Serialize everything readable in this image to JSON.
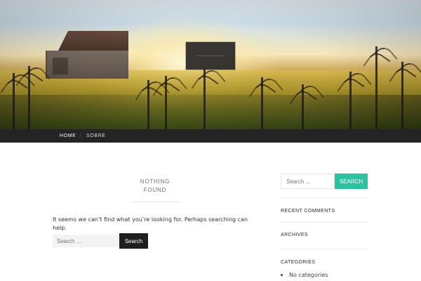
{
  "nav": {
    "items": [
      {
        "label": "HOME",
        "active": true
      },
      {
        "label": "SOBRE",
        "active": false
      }
    ]
  },
  "main": {
    "not_found": {
      "title_line_1": "NOTHING",
      "title_line_2": "FOUND",
      "message": "It seems we can’t find what you’re looking for. Perhaps searching can help."
    },
    "search": {
      "placeholder": "Search …",
      "button_label": "Search"
    }
  },
  "sidebar": {
    "search": {
      "placeholder": "Search …",
      "button_label": "SEARCH"
    },
    "widgets": [
      {
        "heading": "RECENT COMMENTS"
      },
      {
        "heading": "ARCHIVES"
      },
      {
        "heading": "CATEGORIES"
      }
    ],
    "categories_list": [
      "No categories"
    ]
  },
  "colors": {
    "nav_background": "#242424",
    "sidebar_search_button": "#2bc2a0",
    "main_search_button": "#1f1f1f",
    "hero_title_box": "#262626"
  }
}
